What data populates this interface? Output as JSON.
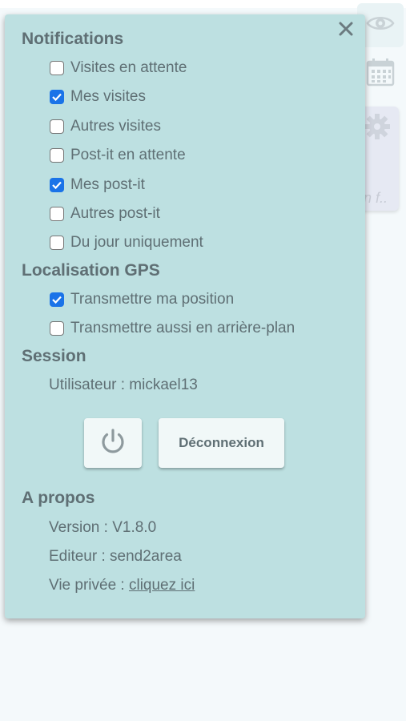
{
  "panel": {
    "close_icon": "close-icon",
    "notifications": {
      "title": "Notifications",
      "items": [
        {
          "label": "Visites en attente",
          "checked": false
        },
        {
          "label": "Mes visites",
          "checked": true
        },
        {
          "label": "Autres visites",
          "checked": false
        },
        {
          "label": "Post-it en attente",
          "checked": false
        },
        {
          "label": "Mes post-it",
          "checked": true
        },
        {
          "label": "Autres post-it",
          "checked": false
        },
        {
          "label": "Du jour uniquement",
          "checked": false
        }
      ]
    },
    "gps": {
      "title": "Localisation GPS",
      "items": [
        {
          "label": "Transmettre ma position",
          "checked": true
        },
        {
          "label": "Transmettre aussi en arrière-plan",
          "checked": false
        }
      ]
    },
    "session": {
      "title": "Session",
      "user_line": "Utilisateur : mickael13",
      "power_icon": "power-icon",
      "logout_label": "Déconnexion"
    },
    "about": {
      "title": "A propos",
      "version": "Version : V1.8.0",
      "editor": "Editeur : send2area",
      "privacy_prefix": "Vie privée : ",
      "privacy_link": "cliquez ici"
    }
  },
  "background": {
    "card_snippet": "n f..",
    "icons": [
      "eye-icon",
      "calendar-icon",
      "gear-icon"
    ]
  },
  "colors": {
    "panel_bg": "#bde0e1",
    "text": "#5f6f74",
    "checkbox_checked": "#1a73e8",
    "button_bg": "#f1f8f8"
  }
}
